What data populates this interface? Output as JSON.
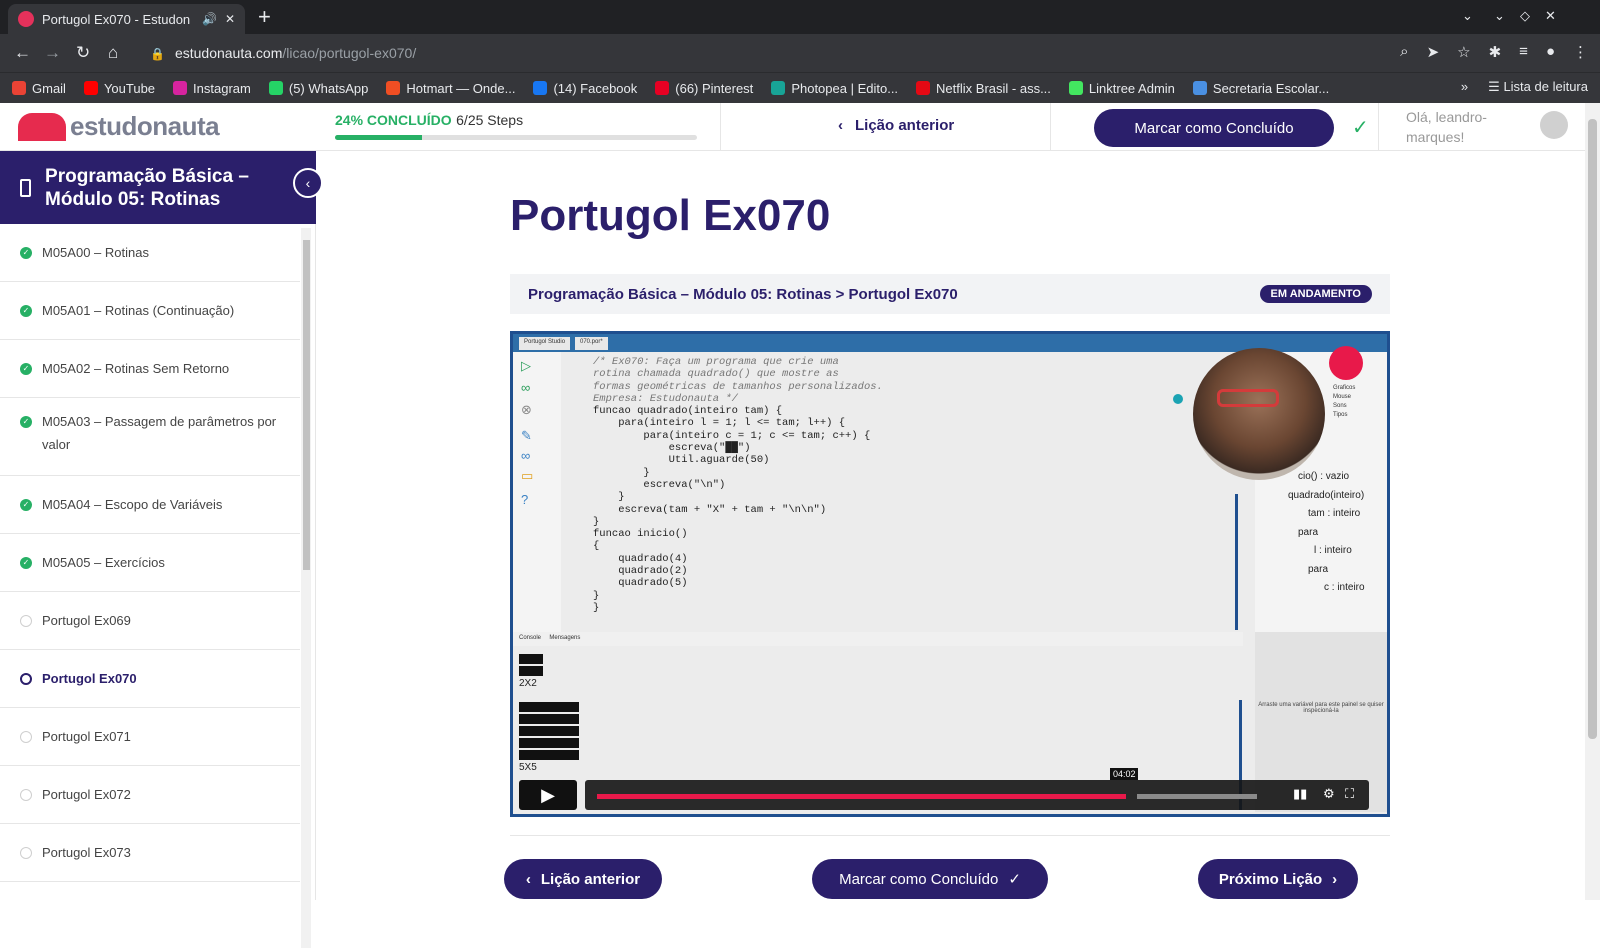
{
  "browser": {
    "tab_title": "Portugol Ex070 - Estudon",
    "url_host": "estudonauta.com",
    "url_path": "/licao/portugol-ex070/",
    "bookmarks": [
      {
        "label": "Gmail",
        "color": "#ea4335"
      },
      {
        "label": "YouTube",
        "color": "#ff0000"
      },
      {
        "label": "Instagram",
        "color": "#d6249f"
      },
      {
        "label": "(5) WhatsApp",
        "color": "#25d366"
      },
      {
        "label": "Hotmart — Onde...",
        "color": "#f04e23"
      },
      {
        "label": "(14) Facebook",
        "color": "#1877f2"
      },
      {
        "label": "(66) Pinterest",
        "color": "#e60023"
      },
      {
        "label": "Photopea | Edito...",
        "color": "#18a497"
      },
      {
        "label": "Netflix Brasil - ass...",
        "color": "#e50914"
      },
      {
        "label": "Linktree Admin",
        "color": "#43e660"
      },
      {
        "label": "Secretaria Escolar...",
        "color": "#4a90e2"
      }
    ],
    "reading_list": "Lista de leitura"
  },
  "header": {
    "logo_text": "estudonauta",
    "progress_pct_label": "24% CONCLUÍDO",
    "progress_steps": "6/25 Steps",
    "progress_value": 0.24,
    "prev_label": "Lição anterior",
    "mark_label": "Marcar como Concluído",
    "greeting": "Olá, leandro-marques!"
  },
  "sidebar": {
    "title": "Programação Básica – Módulo 05: Rotinas",
    "items": [
      {
        "label": "M05A00 – Rotinas",
        "status": "done"
      },
      {
        "label": "M05A01 – Rotinas (Continuação)",
        "status": "done"
      },
      {
        "label": "M05A02 – Rotinas Sem Retorno",
        "status": "done"
      },
      {
        "label": "M05A03 – Passagem de parâmetros por valor",
        "status": "done"
      },
      {
        "label": "M05A04 – Escopo de Variáveis",
        "status": "done"
      },
      {
        "label": "M05A05 – Exercícios",
        "status": "done"
      },
      {
        "label": "Portugol Ex069",
        "status": "todo"
      },
      {
        "label": "Portugol Ex070",
        "status": "current"
      },
      {
        "label": "Portugol Ex071",
        "status": "todo"
      },
      {
        "label": "Portugol Ex072",
        "status": "todo"
      },
      {
        "label": "Portugol Ex073",
        "status": "todo"
      }
    ]
  },
  "main": {
    "title": "Portugol Ex070",
    "breadcrumb_course": "Programação Básica – Módulo 05: Rotinas",
    "breadcrumb_sep": ">",
    "breadcrumb_lesson": "Portugol Ex070",
    "status_badge": "EM ANDAMENTO",
    "video": {
      "ide_tab1": "Portugol Studio",
      "ide_tab2": "070.por*",
      "code_lines": [
        "/* Ex070: Faça um programa que crie uma",
        "rotina chamada quadrado() que mostre as",
        "formas geométricas de tamanhos personalizados.",
        "Empresa: Estudonauta */",
        "",
        "funcao quadrado(inteiro tam) {",
        "    para(inteiro l = 1; l <= tam; l++) {",
        "        para(inteiro c = 1; c <= tam; c++) {",
        "            escreva(\"██\")",
        "            Util.aguarde(50)",
        "        }",
        "        escreva(\"\\n\")",
        "    }",
        "    escreva(tam + \"X\" + tam + \"\\n\\n\")",
        "}",
        "funcao inicio()",
        "{",
        "    quadrado(4)",
        "    quadrado(2)",
        "    quadrado(5)",
        "}",
        "",
        "}"
      ],
      "tree": [
        "cio() : vazio",
        "quadrado(inteiro)",
        "tam : inteiro",
        "para",
        "l : inteiro",
        "para",
        "c : inteiro"
      ],
      "right_menu": [
        "Graficos",
        "Mouse",
        "Sons",
        "Tipos"
      ],
      "console_tab": "Console",
      "messages_tab": "Mensagens",
      "output_label_1": "2X2",
      "output_label_2": "5X5",
      "inspect_hint": "Arraste uma variável para este painel se quiser inspecioná-la",
      "time": "04:02",
      "progress": 0.69
    },
    "bottom_prev": "Lição anterior",
    "bottom_mark": "Marcar como Concluído",
    "bottom_next": "Próximo Lição"
  }
}
